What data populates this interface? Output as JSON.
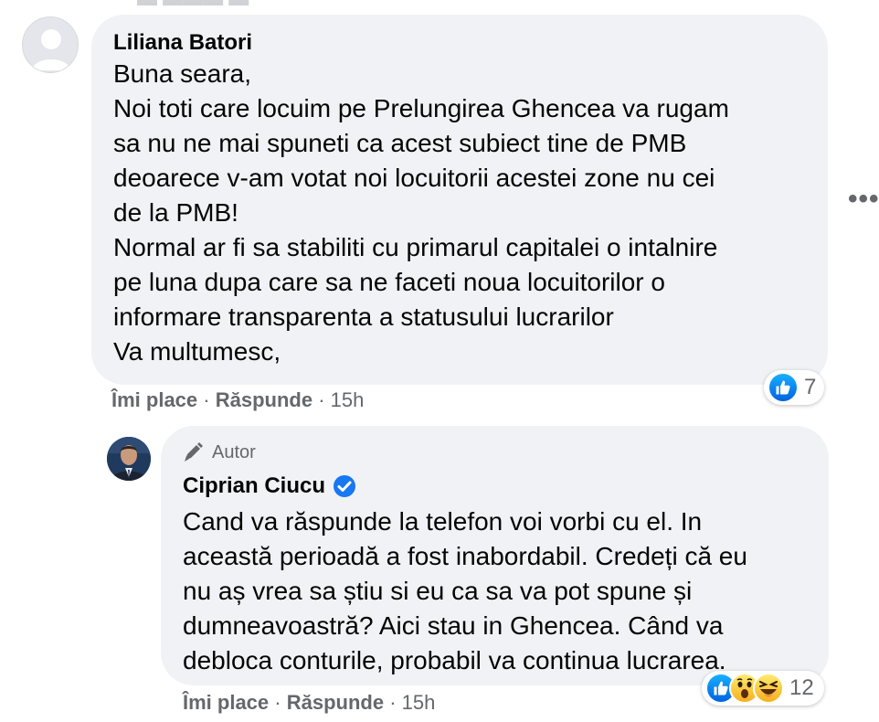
{
  "thread": {
    "comment": {
      "author": "Liliana Batori",
      "body_lines": [
        "Buna seara,",
        "Noi toti care locuim pe Prelungirea Ghencea va rugam",
        "sa nu ne mai spuneti ca acest subiect tine de PMB",
        "deoarece v-am votat noi locuitorii acestei zone nu cei",
        "de la PMB!",
        "Normal ar fi sa stabiliti cu primarul capitalei o intalnire",
        "pe luna dupa care sa ne faceti noua locuitorilor o",
        "informare transparenta a statusului lucrarilor",
        "Va multumesc,"
      ],
      "actions": {
        "like": "Îmi place",
        "reply": "Răspunde",
        "separator": "·",
        "time": "15h"
      },
      "reactions": {
        "icons": [
          "like-icon"
        ],
        "count": "7"
      },
      "more_icon": "more-horizontal-icon",
      "more_label": "•••"
    },
    "reply": {
      "badge": "Autor",
      "badge_icon": "pencil-icon",
      "author": "Ciprian Ciucu",
      "verified_icon": "verified-badge-icon",
      "body_lines": [
        "Cand va răspunde la telefon voi vorbi cu el. In",
        "această perioadă a fost inabordabil. Credeți că eu",
        "nu aș vrea sa știu si eu ca sa va pot spune și",
        "dumneavoastră? Aici stau in Ghencea. Când va",
        "debloca conturile, probabil va continua lucrarea."
      ],
      "actions": {
        "like": "Îmi place",
        "reply": "Răspunde",
        "separator": "·",
        "time": "15h"
      },
      "reactions": {
        "icons": [
          "like-icon",
          "wow-icon",
          "haha-icon"
        ],
        "count": "12"
      }
    }
  },
  "colors": {
    "bubble": "#f0f2f5",
    "meta_text": "#65676b",
    "like_blue": "#1877f2",
    "text": "#050505"
  }
}
